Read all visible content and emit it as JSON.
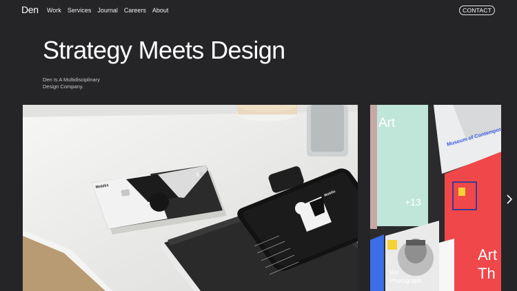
{
  "nav": {
    "logo": "Den",
    "links": [
      "Work",
      "Services",
      "Journal",
      "Careers",
      "About"
    ],
    "contact": "CONTACT"
  },
  "hero": {
    "title": "Strategy Meets Design",
    "subtitle_line1": "Den Is A Multidisciplinary",
    "subtitle_line2": "Design Company."
  },
  "gallery": {
    "card_brand": "Mobilis",
    "phone_brand": "Mobilis",
    "side_texts": {
      "art_top": "Art",
      "museum": "Museum of Contemporary Art",
      "count": "+13",
      "art_big_1": "Art",
      "art_big_2": "Th",
      "photo_caption_1": "We",
      "photo_caption_2": "Photograph"
    }
  },
  "colors": {
    "background": "#252527",
    "mint": "#bfe6d8",
    "red": "#f0474a",
    "blue": "#3b6de6",
    "yellow": "#f5d234"
  },
  "icons": {
    "next": "chevron-right-icon"
  }
}
